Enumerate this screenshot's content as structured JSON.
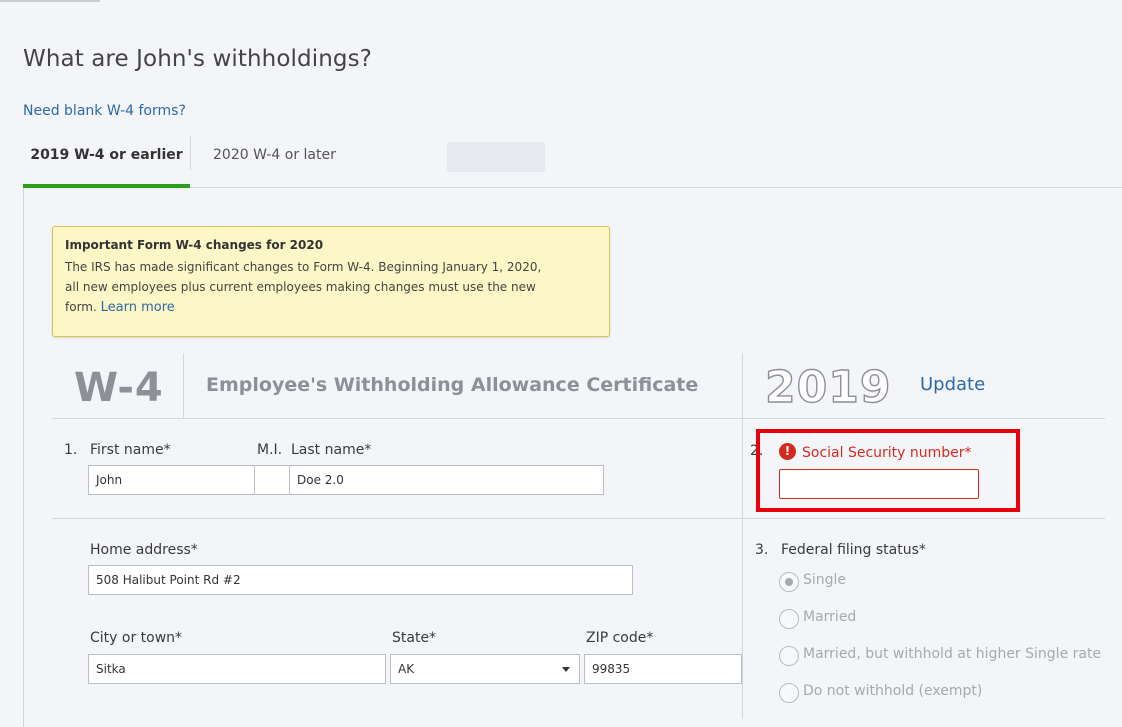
{
  "page": {
    "title": "What are John's withholdings?",
    "blank_forms_link": "Need blank W-4 forms?"
  },
  "tabs": [
    {
      "label": "2019 W-4 or earlier",
      "active": true
    },
    {
      "label": "2020 W-4 or later",
      "active": false
    }
  ],
  "notice": {
    "title": "Important Form W-4 changes for 2020",
    "body": "The IRS has made significant changes to Form W-4. Beginning January 1, 2020, all new employees plus current employees making changes must use the new form.",
    "link": "Learn more"
  },
  "form": {
    "form_id": "W-4",
    "certificate_title": "Employee's Withholding Allowance Certificate",
    "year": "2019",
    "update_link": "Update",
    "section1_number": "1.",
    "first_name": {
      "label": "First name*",
      "value": "John"
    },
    "middle_initial": {
      "label": "M.I.",
      "value": ""
    },
    "last_name": {
      "label": "Last name*",
      "value": "Doe 2.0"
    },
    "section2_number": "2.",
    "ssn": {
      "label": "Social Security number*",
      "value": "",
      "error_icon": "!"
    },
    "home_address": {
      "label": "Home address*",
      "value": "508 Halibut Point Rd #2"
    },
    "city": {
      "label": "City or town*",
      "value": "Sitka"
    },
    "state": {
      "label": "State*",
      "value": "AK"
    },
    "zip": {
      "label": "ZIP code*",
      "value": "99835"
    },
    "section3_number": "3.",
    "filing_status": {
      "label": "Federal filing status*",
      "options": [
        "Single",
        "Married",
        "Married, but withhold at higher Single rate",
        "Do not withhold (exempt)"
      ],
      "selected": "Single"
    }
  },
  "colors": {
    "accent_green": "#2ca01c",
    "link_blue": "#2c6aa8",
    "error_red": "#d52b1e",
    "highlight_red": "#e8000b"
  }
}
